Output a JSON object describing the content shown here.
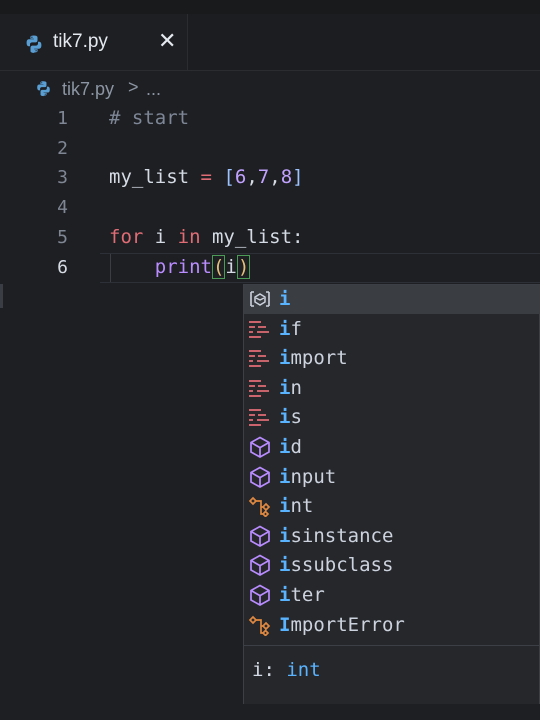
{
  "tab": {
    "filename": "tik7.py",
    "close_glyph": "✕"
  },
  "breadcrumb": {
    "file": "tik7.py",
    "separator": ">",
    "more": "..."
  },
  "editor": {
    "active_line": 6,
    "lines": [
      {
        "num": "1",
        "tokens": [
          {
            "t": "# start",
            "c": "cmt"
          }
        ]
      },
      {
        "num": "2",
        "tokens": []
      },
      {
        "num": "3",
        "tokens": [
          {
            "t": "my_list",
            "c": "var"
          },
          {
            "t": " ",
            "c": "var"
          },
          {
            "t": "=",
            "c": "op"
          },
          {
            "t": " ",
            "c": "var"
          },
          {
            "t": "[",
            "c": "brk"
          },
          {
            "t": "6",
            "c": "num"
          },
          {
            "t": ",",
            "c": "var"
          },
          {
            "t": "7",
            "c": "num"
          },
          {
            "t": ",",
            "c": "var"
          },
          {
            "t": "8",
            "c": "num"
          },
          {
            "t": "]",
            "c": "brk"
          }
        ]
      },
      {
        "num": "4",
        "tokens": []
      },
      {
        "num": "5",
        "tokens": [
          {
            "t": "for",
            "c": "kw"
          },
          {
            "t": " i ",
            "c": "var"
          },
          {
            "t": "in",
            "c": "kw"
          },
          {
            "t": " my_list:",
            "c": "var"
          }
        ]
      },
      {
        "num": "6",
        "tokens": [
          {
            "t": "    ",
            "c": "var"
          },
          {
            "t": "print",
            "c": "fn"
          },
          {
            "t": "(",
            "c": "par"
          },
          {
            "t": "i",
            "c": "var"
          },
          {
            "t": ")",
            "c": "par"
          }
        ]
      }
    ]
  },
  "suggestions": {
    "selected_index": 0,
    "items": [
      {
        "label": "i",
        "match": "i",
        "kind": "variable-icon"
      },
      {
        "label": "if",
        "match": "i",
        "kind": "keyword-icon"
      },
      {
        "label": "import",
        "match": "i",
        "kind": "keyword-icon"
      },
      {
        "label": "in",
        "match": "i",
        "kind": "keyword-icon"
      },
      {
        "label": "is",
        "match": "i",
        "kind": "keyword-icon"
      },
      {
        "label": "id",
        "match": "i",
        "kind": "function-icon"
      },
      {
        "label": "input",
        "match": "i",
        "kind": "function-icon"
      },
      {
        "label": "int",
        "match": "i",
        "kind": "class-icon"
      },
      {
        "label": "isinstance",
        "match": "i",
        "kind": "function-icon"
      },
      {
        "label": "issubclass",
        "match": "i",
        "kind": "function-icon"
      },
      {
        "label": "iter",
        "match": "i",
        "kind": "function-icon"
      },
      {
        "label": "ImportError",
        "match": "I",
        "kind": "class-icon"
      }
    ],
    "detail_name": "i: ",
    "detail_type": "int"
  },
  "colors": {
    "keyword": "#e06c75",
    "function": "#b98cff",
    "class": "#e0883f",
    "match": "#59b3ff"
  }
}
